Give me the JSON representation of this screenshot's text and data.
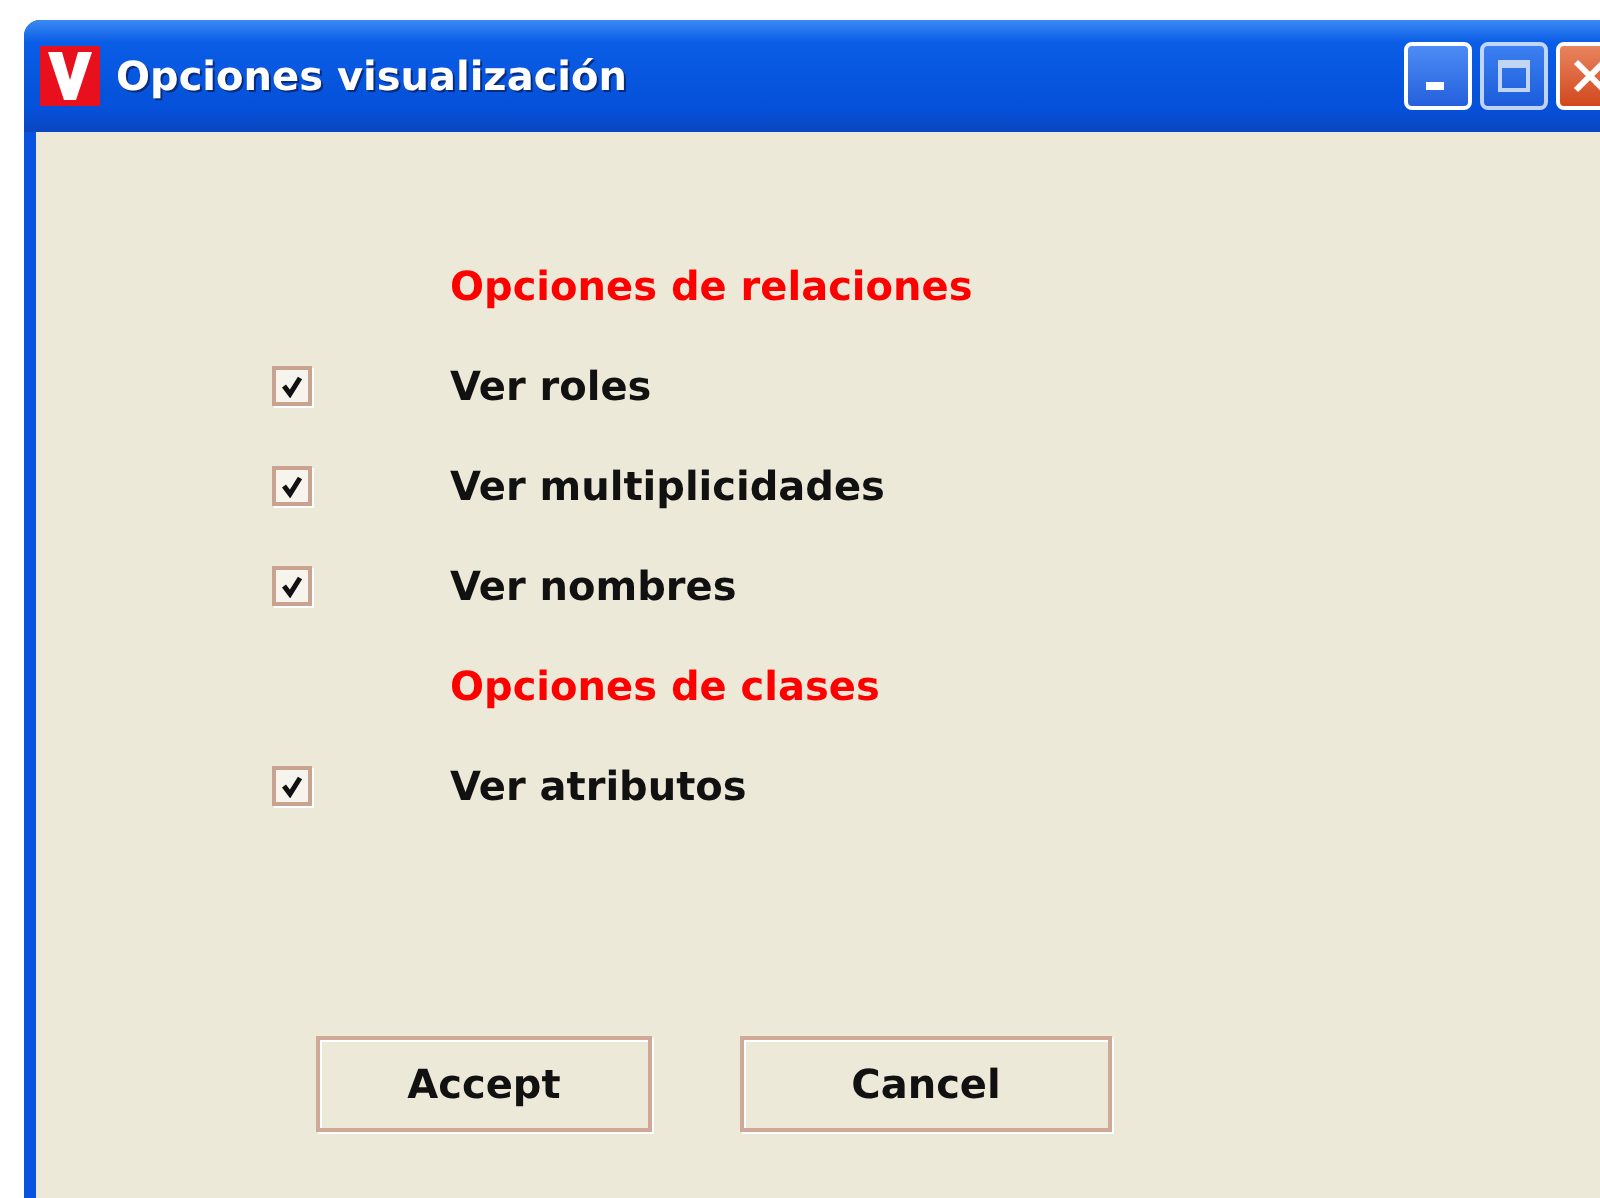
{
  "window": {
    "title": "Opciones visualización"
  },
  "options": [
    {
      "kind": "header",
      "label": "Opciones de relaciones"
    },
    {
      "kind": "checkbox",
      "label": "Ver roles",
      "checked": true
    },
    {
      "kind": "checkbox",
      "label": "Ver multiplicidades",
      "checked": true
    },
    {
      "kind": "checkbox",
      "label": "Ver nombres",
      "checked": true
    },
    {
      "kind": "header",
      "label": "Opciones de clases"
    },
    {
      "kind": "checkbox",
      "label": "Ver atributos",
      "checked": true
    }
  ],
  "buttons": [
    "Accept",
    "Cancel"
  ]
}
